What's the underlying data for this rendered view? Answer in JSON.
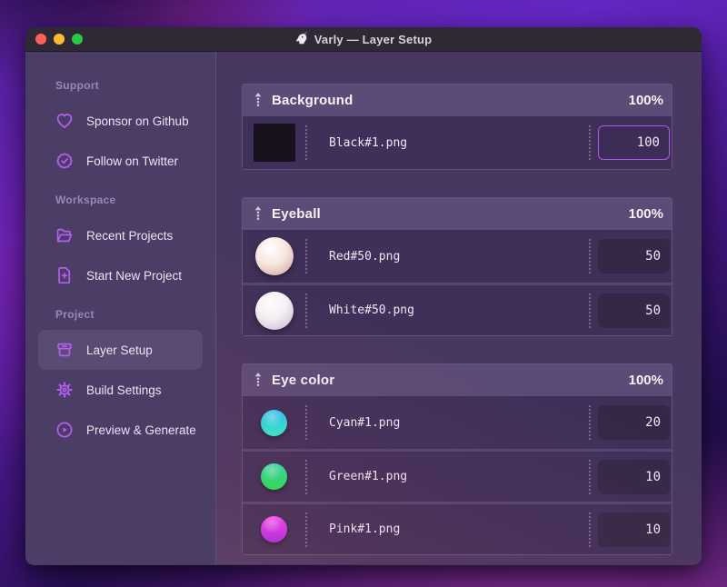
{
  "window": {
    "title": "Varly — Layer Setup",
    "app_icon": "unicorn-icon"
  },
  "colors": {
    "accent": "#ab59ee",
    "traffic_close": "#ff5f57",
    "traffic_minimize": "#febc2e",
    "traffic_zoom": "#28c840"
  },
  "sidebar": {
    "sections": [
      {
        "label": "Support",
        "items": [
          {
            "icon": "heart-icon",
            "label": "Sponsor on Github",
            "active": false
          },
          {
            "icon": "badge-check-icon",
            "label": "Follow on Twitter",
            "active": false
          }
        ]
      },
      {
        "label": "Workspace",
        "items": [
          {
            "icon": "folder-open-icon",
            "label": "Recent Projects",
            "active": false
          },
          {
            "icon": "file-plus-icon",
            "label": "Start New Project",
            "active": false
          }
        ]
      },
      {
        "label": "Project",
        "items": [
          {
            "icon": "archive-box-icon",
            "label": "Layer Setup",
            "active": true
          },
          {
            "icon": "gear-icon",
            "label": "Build Settings",
            "active": false
          },
          {
            "icon": "play-circle-icon",
            "label": "Preview & Generate",
            "active": false
          }
        ]
      }
    ]
  },
  "layers": {
    "groups": [
      {
        "name": "Background",
        "opacity": "100%",
        "rows": [
          {
            "thumb": "black",
            "file": "Black#1.png",
            "weight": "100",
            "focused": true
          }
        ]
      },
      {
        "name": "Eyeball",
        "opacity": "100%",
        "rows": [
          {
            "thumb": "red",
            "file": "Red#50.png",
            "weight": "50",
            "focused": false
          },
          {
            "thumb": "white",
            "file": "White#50.png",
            "weight": "50",
            "focused": false
          }
        ]
      },
      {
        "name": "Eye color",
        "opacity": "100%",
        "rows": [
          {
            "thumb": "cyan",
            "file": "Cyan#1.png",
            "weight": "20",
            "focused": false
          },
          {
            "thumb": "green",
            "file": "Green#1.png",
            "weight": "10",
            "focused": false
          },
          {
            "thumb": "pink",
            "file": "Pink#1.png",
            "weight": "10",
            "focused": false
          }
        ]
      }
    ]
  },
  "thumbs": {
    "black": {
      "kind": "square",
      "color": "#17111d"
    },
    "red": {
      "kind": "sphere",
      "hi": "#ffffff",
      "mid": "#f8e6e0",
      "edge": "#cfa099"
    },
    "white": {
      "kind": "sphere",
      "hi": "#ffffff",
      "mid": "#f4f1f6",
      "edge": "#bfb7ca"
    },
    "cyan": {
      "kind": "ball",
      "from": "#2cc1f6",
      "to": "#31edc4"
    },
    "green": {
      "kind": "ball",
      "from": "#2fd6a2",
      "to": "#23e255"
    },
    "pink": {
      "kind": "ball",
      "from": "#ef41f2",
      "to": "#a92ce2"
    }
  }
}
